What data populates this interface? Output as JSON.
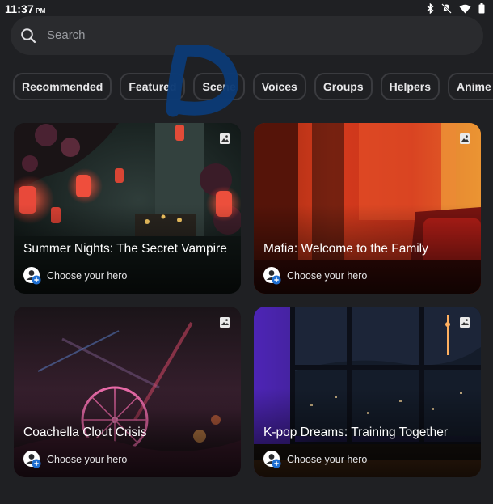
{
  "status": {
    "time": "11:37",
    "ampm": "PM"
  },
  "search": {
    "placeholder": "Search"
  },
  "chips": [
    "Recommended",
    "Featured",
    "Scene",
    "Voices",
    "Groups",
    "Helpers",
    "Anime Game C"
  ],
  "cards": [
    {
      "title": "Summer Nights: The Secret Vampire",
      "hero": "Choose your hero"
    },
    {
      "title": "Mafia: Welcome to the Family",
      "hero": "Choose your hero"
    },
    {
      "title": "Coachella Clout Crisis",
      "hero": "Choose your hero"
    },
    {
      "title": "K-pop Dreams: Training Together",
      "hero": "Choose your hero"
    }
  ],
  "colors": {
    "background": "#1f2023",
    "chip_border": "#3a3b3f",
    "annotation": "#0b3a75",
    "avatar_plus": "#1f6fd1"
  }
}
